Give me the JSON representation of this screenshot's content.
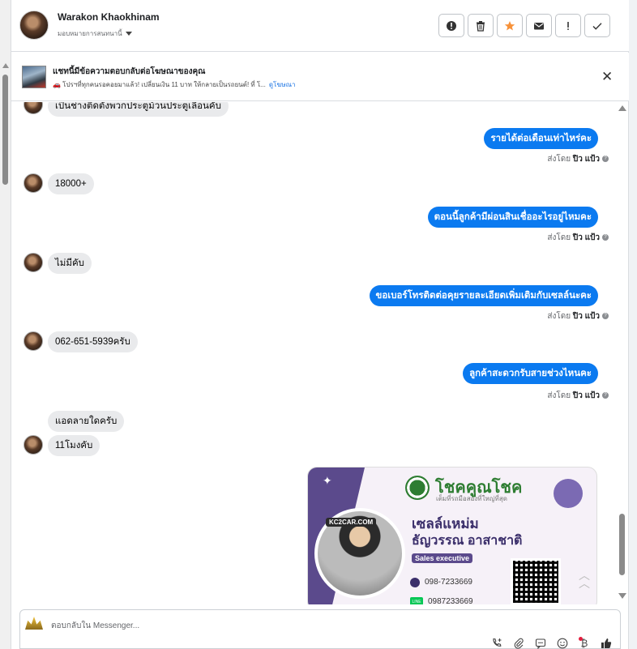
{
  "header": {
    "user_name": "Warakon Khaokhinam",
    "assign_label": "มอบหมายการสนทนานี้",
    "tools": [
      "exclamation-circle-icon",
      "trash-icon",
      "star-icon",
      "envelope-icon",
      "exclamation-icon",
      "check-icon"
    ],
    "star_color": "#f7923a"
  },
  "banner": {
    "title": "แชทนี้มีข้อความตอบกลับต่อโฆษณาของคุณ",
    "text": "🚗 โปรฯที่ทุกคนรอคอยมาแล้ว! เปลี่ยนเงิน 11 บาท ให้กลายเป็นรถยนต์! ที่ โ...",
    "link": "ดูโฆษณา"
  },
  "messages": {
    "in_1": "เป็นช่างติดตั้งพวกประตูม้วนประตูเลื่อนคับ",
    "out_1": "รายได้ต่อเดือนเท่าไหร่คะ",
    "in_2": "18000+",
    "out_2": "ตอนนี้ลูกค้ามีผ่อนสินเชื่ออะไรอยู่ไหมคะ",
    "in_3": "ไม่มีคับ",
    "out_3": "ขอเบอร์โทรติดต่อคุยรายละเอียดเพิ่มเติมกับเซลล์นะคะ",
    "in_4": "062-651-5939ครับ",
    "out_4": "ลูกค้าสะดวกรับสายช่วงไหนคะ",
    "in_5": "แอดลายใดครับ",
    "in_6": "11โมงคับ",
    "sent_by_label": "ส่งโดย",
    "sent_by_name": "ปิว แป้ว",
    "bubble_out_color": "#0b7af0",
    "bubble_in_color": "#e9eaec"
  },
  "card": {
    "brand": "โชคคูณโชค",
    "brand_sub": "เต็มที่รถมือสองที่ใหญ่ที่สุด",
    "site": "KC2CAR.COM",
    "name_line1": "เซลล์แหม่ม",
    "name_line2": "ธัญวรรณ  อาสาชาติ",
    "role": "Sales executive",
    "phone1": "098-7233669",
    "phone2": "0987233669",
    "line_label": "LINE"
  },
  "composer": {
    "placeholder": "ตอบกลับใน Messenger...",
    "icons": [
      "phone-plus-icon",
      "paperclip-icon",
      "saved-reply-icon",
      "emoji-icon",
      "bitcoin-icon",
      "thumbs-up-icon"
    ]
  }
}
